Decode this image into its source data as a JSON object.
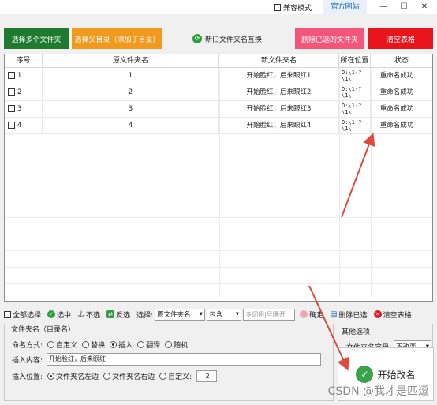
{
  "titlebar": {
    "compat_label": "兼容模式",
    "site_label": "官方网站",
    "minimize": "—",
    "maximize": "☐",
    "close": "✕"
  },
  "toolbar": {
    "select_folders": "选择多个文件夹",
    "select_parent": "选择父目录（添加子目录）",
    "swap_names": "新旧文件夹名互换",
    "delete_selected": "删除已选的文件夹",
    "clear_table": "清空表格",
    "colors": {
      "green": "#1e7a2e",
      "orange": "#f29a1e",
      "pink": "#f2567a",
      "red": "#e8161c"
    }
  },
  "table": {
    "headers": [
      "序号",
      "原文件夹名",
      "新文件夹名",
      "所在位置",
      "状态"
    ],
    "rows": [
      {
        "index": "1",
        "old": "1",
        "new": "开始脸红，后来眼红1",
        "loc": "D:\\1-?\n\\1\\",
        "status": "重命名成功"
      },
      {
        "index": "2",
        "old": "2",
        "new": "开始脸红，后来眼红2",
        "loc": "D:\\1-?\n\\1\\",
        "status": "重命名成功"
      },
      {
        "index": "3",
        "old": "3",
        "new": "开始脸红，后来眼红3",
        "loc": "D:\\1-?\n\\1\\",
        "status": "重命名成功"
      },
      {
        "index": "4",
        "old": "4",
        "new": "开始脸红，后来眼红4",
        "loc": "D:\\1-?\n\\1\\",
        "status": "重命名成功"
      }
    ]
  },
  "actionbar": {
    "select_all": "全部选择",
    "select": "选中",
    "unselect": "不选",
    "invert": "反选",
    "choose_label": "选择:",
    "column_value": "原文件夹名",
    "match_value": "包含",
    "filter_placeholder": "多词用|号隔开",
    "confirm": "确定",
    "delete_selected": "删除已选",
    "clear_table": "清空表格"
  },
  "panel": {
    "title": "文件夹名（目录名）",
    "mode_label": "命名方式:",
    "modes": [
      "自定义",
      "替换",
      "插入",
      "翻译",
      "随机"
    ],
    "mode_selected": "插入",
    "content_label": "插入内容:",
    "content_value": "开始脸红，后来眼红",
    "position_label": "插入位置:",
    "positions": [
      "文件夹名左边",
      "文件夹名右边",
      "自定义:"
    ],
    "position_selected": "文件夹名左边",
    "custom_value": "2"
  },
  "other": {
    "title": "其他选项",
    "case_label": "文件夹名字母:",
    "case_value": "不改变"
  },
  "start_button": "开始改名",
  "watermark": "CSDN @我才是匹逗"
}
